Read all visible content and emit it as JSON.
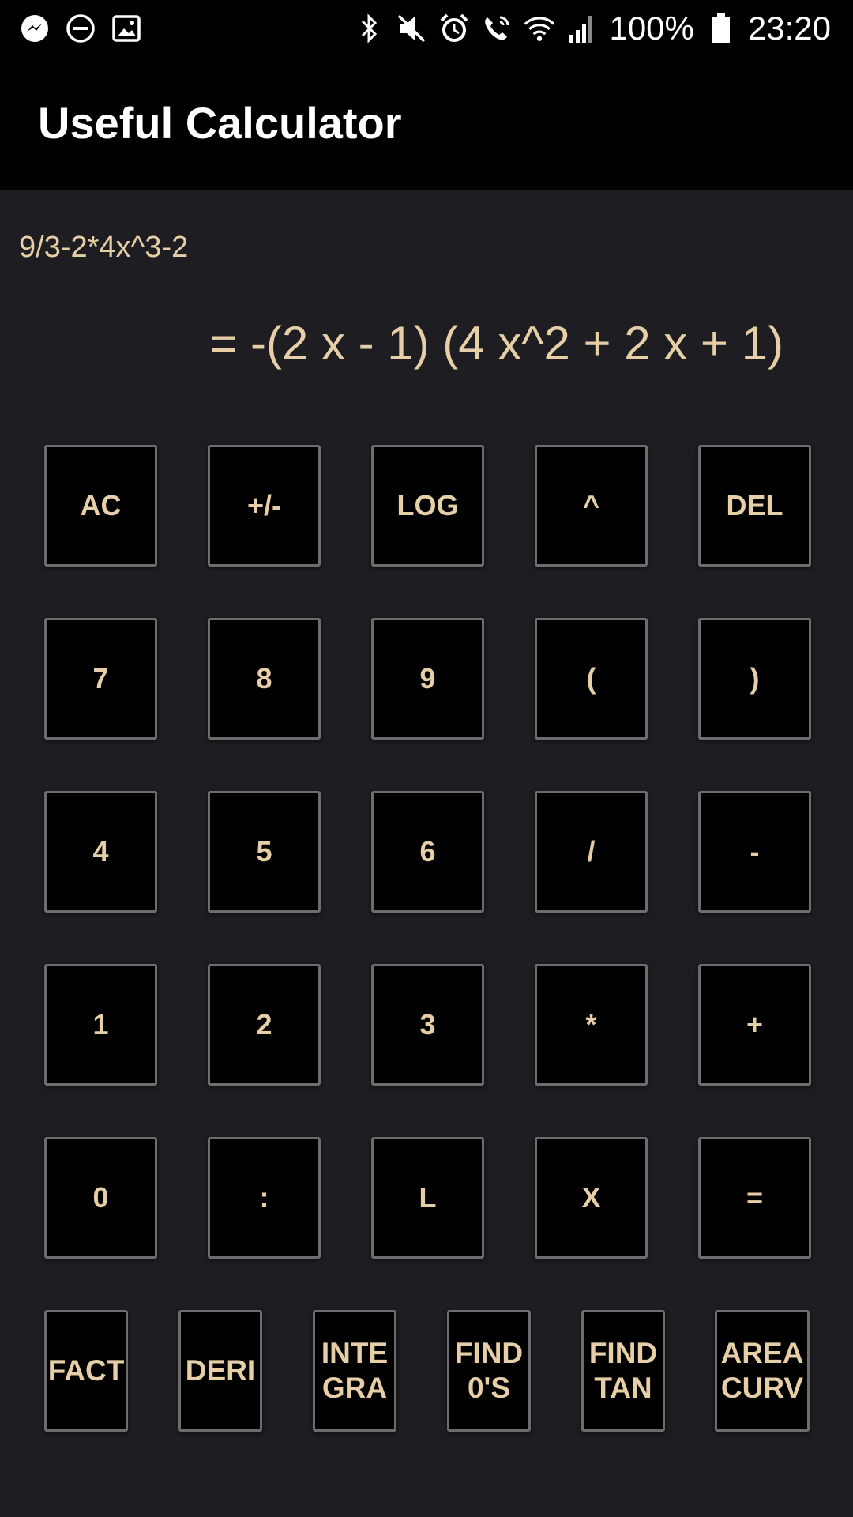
{
  "status_bar": {
    "battery": "100%",
    "time": "23:20",
    "icons": [
      "messenger-icon",
      "do-not-disturb-icon",
      "gallery-icon",
      "bluetooth-icon",
      "mute-icon",
      "alarm-icon",
      "wifi-calling-icon",
      "wifi-icon",
      "signal-icon",
      "battery-icon"
    ]
  },
  "app": {
    "title": "Useful Calculator"
  },
  "display": {
    "expression": "9/3-2*4x^3-2",
    "result": "= -(2 x - 1) (4 x^2 + 2 x + 1)"
  },
  "keypad": {
    "rows": [
      [
        "AC",
        "+/-",
        "LOG",
        "^",
        "DEL"
      ],
      [
        "7",
        "8",
        "9",
        "(",
        ")"
      ],
      [
        "4",
        "5",
        "6",
        "/",
        "-"
      ],
      [
        "1",
        "2",
        "3",
        "*",
        "+"
      ],
      [
        "0",
        ":",
        "L",
        "X",
        "="
      ]
    ],
    "functions": [
      "FACT",
      "DERI",
      "INTE\nGRA",
      "FIND\n0'S",
      "FIND\nTAN",
      "AREA\nCURV"
    ]
  },
  "colors": {
    "accent_text": "#e6cfa6",
    "background": "#1e1e22",
    "key_background": "#000000",
    "key_border": "#6d6d70"
  }
}
